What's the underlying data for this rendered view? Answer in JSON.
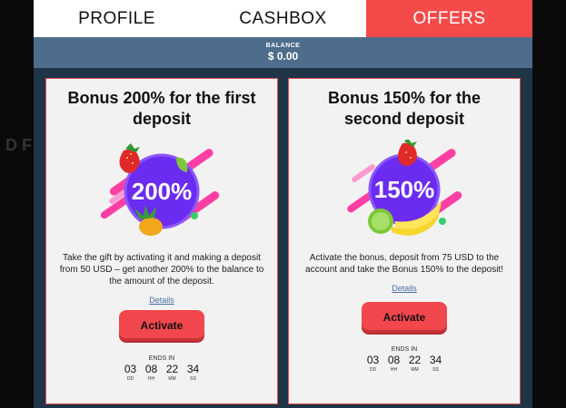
{
  "tabs": [
    {
      "label": "PROFILE",
      "active": false
    },
    {
      "label": "CASHBOX",
      "active": false
    },
    {
      "label": "OFFERS",
      "active": true
    }
  ],
  "balance": {
    "label": "BALANCE",
    "value": "$ 0.00"
  },
  "background_text": "D F",
  "offers": [
    {
      "title": "Bonus 200% for the first deposit",
      "badge_text": "200%",
      "description": "Take the gift by activating it and making a deposit from 50 USD – get another 200% to the balance to the amount of the deposit.",
      "details_label": "Details",
      "activate_label": "Activate",
      "ends_in_label": "ENDS IN",
      "timer": [
        {
          "value": "03",
          "unit": "DD"
        },
        {
          "value": "08",
          "unit": "HH"
        },
        {
          "value": "22",
          "unit": "MM"
        },
        {
          "value": "34",
          "unit": "SS"
        }
      ]
    },
    {
      "title": "Bonus 150% for the second deposit",
      "badge_text": "150%",
      "description": "Activate the bonus, deposit from 75 USD to the account and take the Bonus 150% to the deposit!",
      "details_label": "Details",
      "activate_label": "Activate",
      "ends_in_label": "ENDS IN",
      "timer": [
        {
          "value": "03",
          "unit": "DD"
        },
        {
          "value": "08",
          "unit": "HH"
        },
        {
          "value": "22",
          "unit": "MM"
        },
        {
          "value": "34",
          "unit": "SS"
        }
      ]
    }
  ],
  "colors": {
    "accent": "#f44a4a",
    "panel": "#1f3447",
    "balance_bar": "#4e6c8b",
    "badge_circle": "#6a2cf0"
  }
}
